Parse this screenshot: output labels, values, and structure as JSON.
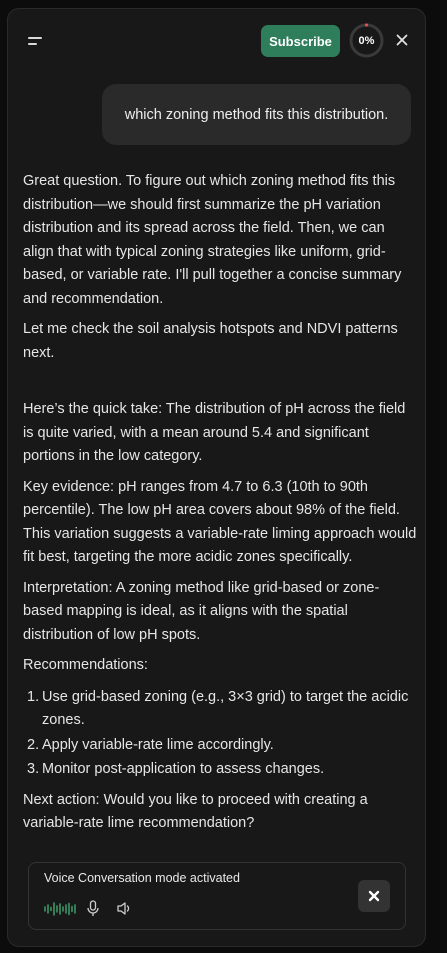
{
  "header": {
    "subscribe_label": "Subscribe",
    "progress_text": "0%",
    "progress_value": 0,
    "accent_color": "#2e7d5b",
    "progress_dot_color": "#e05050"
  },
  "chat": {
    "user_message": "which zoning method fits this distribution.",
    "assistant_intro": "Great question. To figure out which zoning method fits this distribution—we should first summarize the pH variation distribution and its spread across the field. Then, we can align that with typical zoning strategies like uniform, grid-based, or variable rate. I'll pull together a concise summary and recommendation.",
    "assistant_check": "Let me check the soil analysis hotspots and NDVI patterns next.",
    "quick_take": "Here’s the quick take: The distribution of pH across the field is quite varied, with a mean around 5.4 and significant portions in the low category.",
    "key_evidence": "Key evidence: pH ranges from 4.7 to 6.3 (10th to 90th percentile). The low pH area covers about 98% of the field. This variation suggests a variable-rate liming approach would fit best, targeting the more acidic zones specifically.",
    "interpretation": "Interpretation: A zoning method like grid-based or zone-based mapping is ideal, as it aligns with the spatial distribution of low pH spots.",
    "recommendations_heading": "Recommendations:",
    "recommendations": [
      {
        "num": "1.",
        "text": "Use grid-based zoning (e.g., 3×3 grid) to target the acidic zones."
      },
      {
        "num": "2.",
        "text": "Apply variable-rate lime accordingly."
      },
      {
        "num": "3.",
        "text": "Monitor post-application to assess changes."
      }
    ],
    "next_action": "Next action: Would you like to proceed with creating a variable-rate lime recommendation?"
  },
  "voice": {
    "status_text": "Voice Conversation mode activated",
    "wave_color": "#3fa872",
    "icons": [
      "waveform-icon",
      "microphone-icon",
      "speaker-icon",
      "close-icon"
    ]
  }
}
